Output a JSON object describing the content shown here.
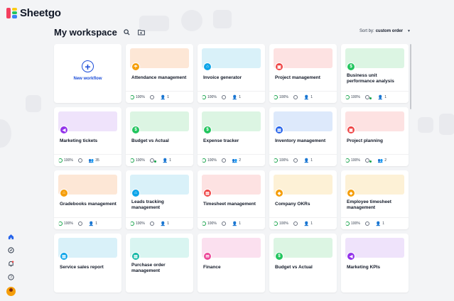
{
  "app": {
    "logo_text": "Sheetgo",
    "logo_colors": [
      "#f43f5e",
      "#22c55e",
      "#3b82f6",
      "#facc15"
    ]
  },
  "header": {
    "title": "My workspace",
    "search_icon": "search-icon",
    "folder_icon": "folder-icon"
  },
  "sort": {
    "label": "Sort by:",
    "value": "custom order",
    "icon": "chevron-down-icon"
  },
  "new_workflow": {
    "label": "New workflow",
    "icon": "plus-circle-icon"
  },
  "cards": [
    {
      "title": "Attendance management",
      "color": "#f59e0b",
      "banner": "#fde7d6",
      "glyph": "☂",
      "health": "100%",
      "sync": false,
      "users": "1"
    },
    {
      "title": "Invoice generator",
      "color": "#0ea5e9",
      "banner": "#d9f1f9",
      "glyph": "⌂",
      "health": "100%",
      "sync": false,
      "users": "1"
    },
    {
      "title": "Project management",
      "color": "#ef4444",
      "banner": "#fde2e2",
      "glyph": "▣",
      "health": "100%",
      "sync": false,
      "users": "1"
    },
    {
      "title": "Business unit performance analysis",
      "color": "#22c55e",
      "banner": "#dcf5e3",
      "glyph": "$",
      "health": "100%",
      "sync": true,
      "users": "1"
    },
    {
      "title": "Marketing tickets",
      "color": "#9333ea",
      "banner": "#efe3fb",
      "glyph": "◀",
      "health": "100%",
      "sync": false,
      "users": "35"
    },
    {
      "title": "Budget vs Actual",
      "color": "#22c55e",
      "banner": "#dcf5e3",
      "glyph": "$",
      "health": "100%",
      "sync": true,
      "users": "1"
    },
    {
      "title": "Expense tracker",
      "color": "#22c55e",
      "banner": "#dcf5e3",
      "glyph": "$",
      "health": "100%",
      "sync": false,
      "users": "2"
    },
    {
      "title": "Inventory management",
      "color": "#2563eb",
      "banner": "#dde9fb",
      "glyph": "▤",
      "health": "100%",
      "sync": false,
      "users": "1"
    },
    {
      "title": "Project planning",
      "color": "#ef4444",
      "banner": "#fde2e2",
      "glyph": "▣",
      "health": "100%",
      "sync": true,
      "users": "2"
    },
    {
      "title": "Gradebooks management",
      "color": "#f59e0b",
      "banner": "#fde7d6",
      "glyph": "⌂",
      "health": "100%",
      "sync": false,
      "users": "1"
    },
    {
      "title": "Leads tracking management",
      "color": "#0ea5e9",
      "banner": "#d9f1f9",
      "glyph": "⌂",
      "health": "100%",
      "sync": false,
      "users": "1"
    },
    {
      "title": "Timesheet management",
      "color": "#ef4444",
      "banner": "#fde2e2",
      "glyph": "▤",
      "health": "100%",
      "sync": false,
      "users": "1"
    },
    {
      "title": "Company OKRs",
      "color": "#f59e0b",
      "banner": "#fdf1d6",
      "glyph": "◆",
      "health": "100%",
      "sync": false,
      "users": "1"
    },
    {
      "title": "Employee timesheet management",
      "color": "#f59e0b",
      "banner": "#fdf1d6",
      "glyph": "◆",
      "health": "100%",
      "sync": false,
      "users": "1"
    },
    {
      "title": "Service sales report",
      "color": "#0ea5e9",
      "banner": "#d9f1f9",
      "glyph": "▤",
      "health": "",
      "sync": false,
      "users": ""
    },
    {
      "title": "Purchase order management",
      "color": "#14b8a6",
      "banner": "#d9f5f1",
      "glyph": "▤",
      "health": "",
      "sync": false,
      "users": ""
    },
    {
      "title": "Finance",
      "color": "#ec4899",
      "banner": "#fbe0ef",
      "glyph": "✉",
      "health": "",
      "sync": false,
      "users": ""
    },
    {
      "title": "Budget vs Actual",
      "color": "#22c55e",
      "banner": "#dcf5e3",
      "glyph": "$",
      "health": "",
      "sync": false,
      "users": ""
    },
    {
      "title": "Marketing KPIs",
      "color": "#9333ea",
      "banner": "#efe3fb",
      "glyph": "◀",
      "health": "",
      "sync": false,
      "users": ""
    }
  ],
  "sidebar": {
    "items": [
      {
        "icon": "home-icon",
        "color": "#2563eb"
      },
      {
        "icon": "compass-icon",
        "color": "#374151"
      },
      {
        "icon": "bell-icon",
        "color": "#374151"
      },
      {
        "icon": "help-icon",
        "color": "#374151"
      },
      {
        "icon": "avatar",
        "color": "#f59e0b"
      }
    ]
  }
}
